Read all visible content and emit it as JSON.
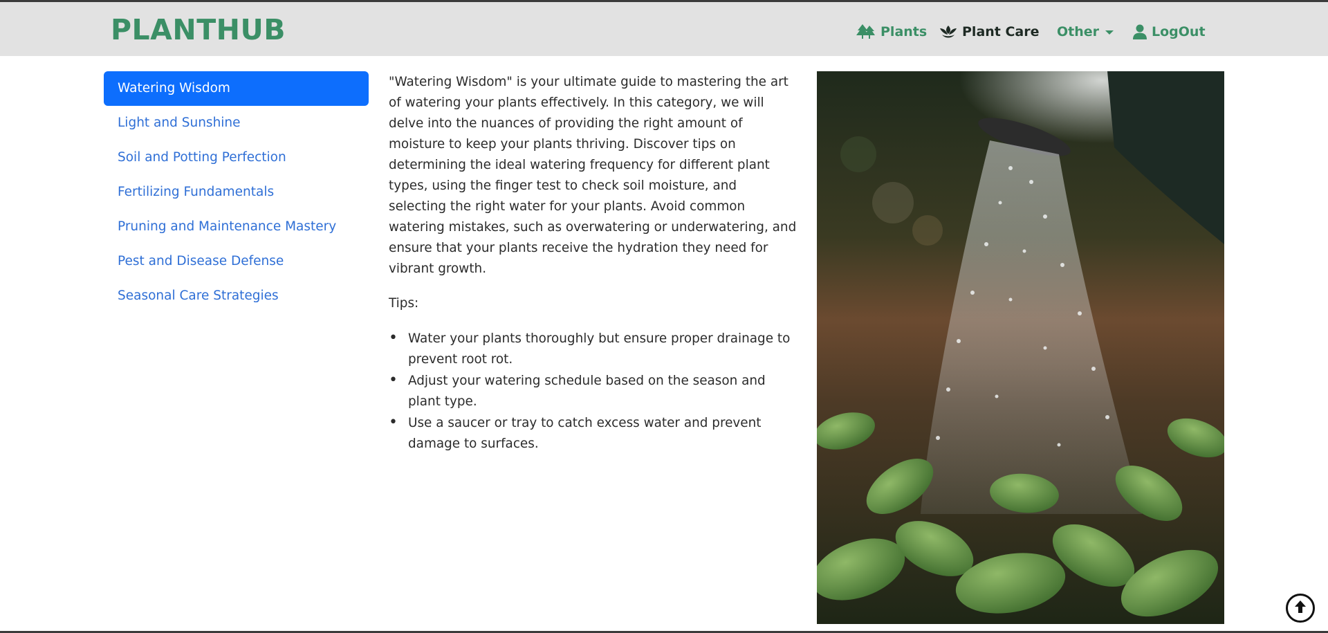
{
  "brand": {
    "name": "PLANTHUB"
  },
  "nav": {
    "plants": {
      "label": "Plants",
      "icon": "trees-icon"
    },
    "plant_care": {
      "label": "Plant Care",
      "icon": "seedling-icon"
    },
    "other": {
      "label": "Other",
      "icon": "caret-down-icon"
    },
    "logout": {
      "label": "LogOut",
      "icon": "user-icon"
    }
  },
  "sidebar": {
    "items": [
      {
        "label": "Watering Wisdom",
        "active": true
      },
      {
        "label": "Light and Sunshine",
        "active": false
      },
      {
        "label": "Soil and Potting Perfection",
        "active": false
      },
      {
        "label": "Fertilizing Fundamentals",
        "active": false
      },
      {
        "label": "Pruning and Maintenance Mastery",
        "active": false
      },
      {
        "label": "Pest and Disease Defense",
        "active": false
      },
      {
        "label": "Seasonal Care Strategies",
        "active": false
      }
    ]
  },
  "content": {
    "intro": "\"Watering Wisdom\" is your ultimate guide to mastering the art of watering your plants effectively. In this category, we will delve into the nuances of providing the right amount of moisture to keep your plants thriving. Discover tips on determining the ideal watering frequency for different plant types, using the finger test to check soil moisture, and selecting the right water for your plants. Avoid common watering mistakes, such as overwatering or underwatering, and ensure that your plants receive the hydration they need for vibrant growth.",
    "tips_heading": "Tips:",
    "tips": [
      "Water your plants thoroughly but ensure proper drainage to prevent root rot.",
      "Adjust your watering schedule based on the season and plant type.",
      "Use a saucer or tray to catch excess water and prevent damage to surfaces."
    ]
  },
  "scroll_top": {
    "icon": "arrow-up-circle-icon"
  },
  "colors": {
    "brand_green": "#3b8f66",
    "active_blue": "#0d6efd",
    "link_blue": "#2f6fd6",
    "navbar_bg": "#e2e2e2"
  }
}
